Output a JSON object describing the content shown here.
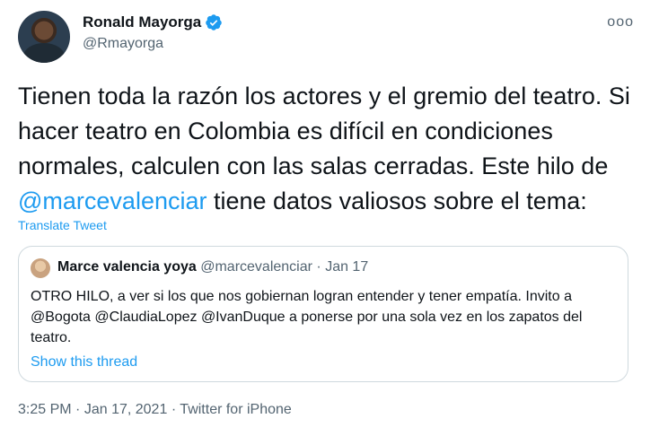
{
  "author": {
    "name": "Ronald Mayorga",
    "handle": "@Rmayorga"
  },
  "menu": {
    "more_label": "ooo"
  },
  "tweet": {
    "text_before": "Tienen toda la razón los actores y el gremio del teatro. Si hacer teatro en Colombia es difícil en condiciones normales, calculen con las salas cerradas. Este hilo de ",
    "mention": "@marcevalenciar",
    "text_after": " tiene datos valiosos sobre el tema:",
    "translate_label": "Translate Tweet"
  },
  "quote": {
    "name": "Marce valencia yoya",
    "handle": "@marcevalenciar",
    "separator": "·",
    "date": "Jan 17",
    "text": "OTRO HILO, a ver si los que nos gobiernan logran entender y tener empatía. Invito a @Bogota @ClaudiaLopez @IvanDuque a ponerse por una sola vez en los zapatos del teatro.",
    "show_thread_label": "Show this thread"
  },
  "footer": {
    "time": "3:25 PM",
    "date": "Jan 17, 2021",
    "source": "Twitter for iPhone",
    "separator": "·"
  },
  "colors": {
    "accent": "#1d9bf0",
    "secondary_text": "#536471",
    "border": "#cfd9de"
  }
}
